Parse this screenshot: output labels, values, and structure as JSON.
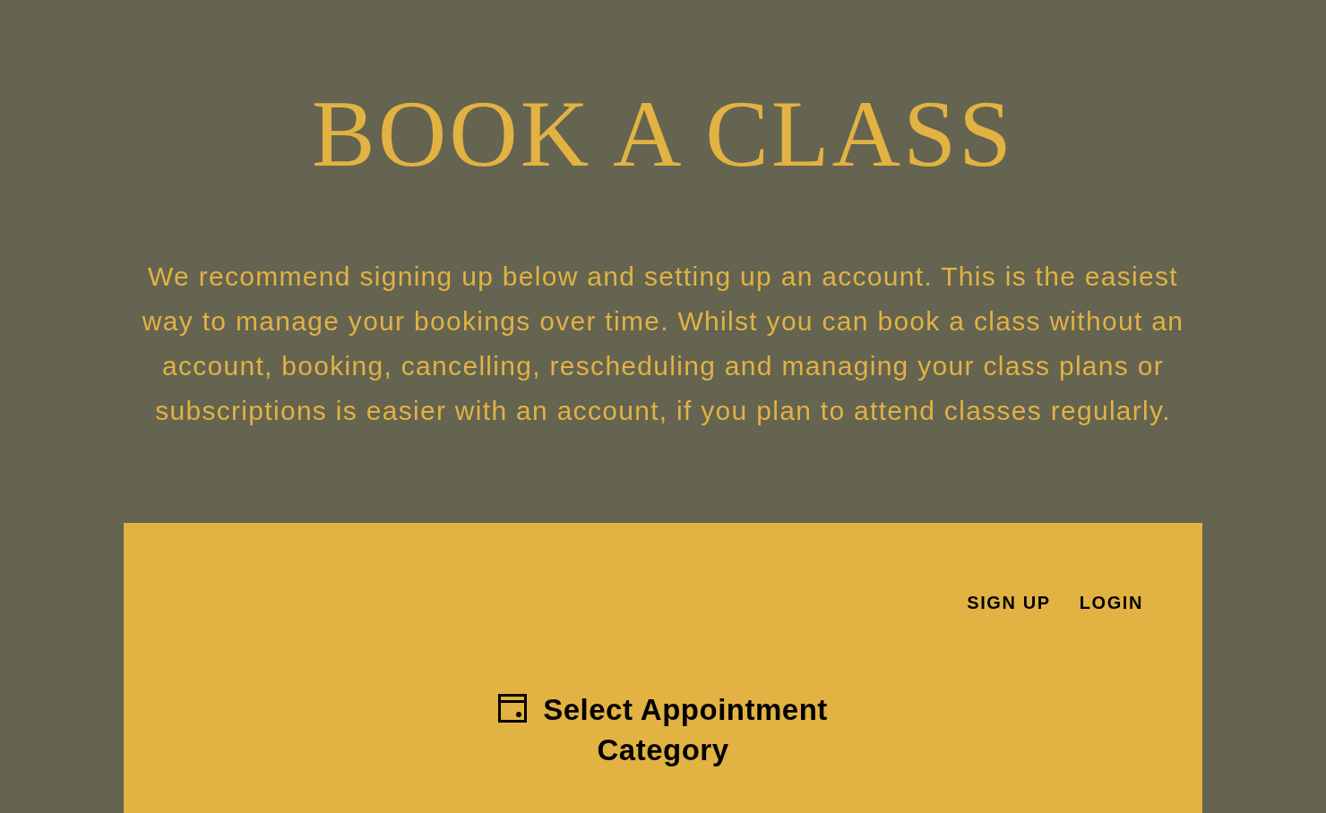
{
  "page": {
    "title": "BOOK A CLASS",
    "intro": "We recommend signing up below and setting up an account. This is the easiest way to manage your bookings over time. Whilst you can book a class without an account, booking, cancelling, rescheduling and managing your class plans or subscriptions is easier with an account, if you plan to attend classes regularly."
  },
  "booking_widget": {
    "nav_links": [
      "SIGN UP",
      "LOGIN"
    ],
    "heading": "Select Appointment Category"
  }
}
